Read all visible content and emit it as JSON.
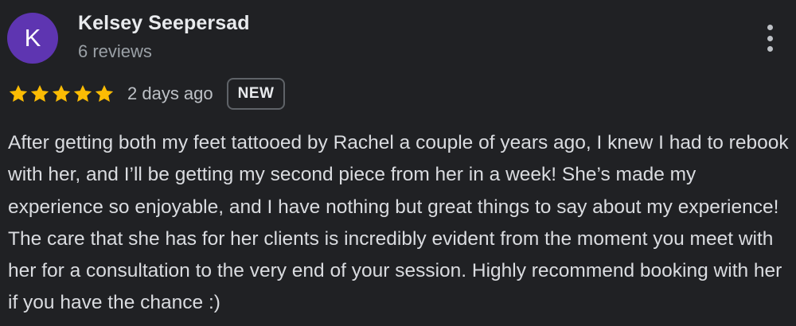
{
  "review": {
    "author": {
      "initial": "K",
      "name": "Kelsey Seepersad",
      "review_count": "6 reviews",
      "avatar_color": "#5e35b1"
    },
    "rating": 5,
    "star_color": "#fbbc04",
    "time_ago": "2 days ago",
    "badge": "NEW",
    "text": "After getting both my feet tattooed by Rachel a couple of years ago, I knew I had to rebook with her, and I’ll be getting my second piece from her in a week! She’s made my experience so enjoyable, and I have nothing but great things to say about my experience! The care that she has for her clients is incredibly evident from the moment you meet with her for a consultation to the very end of your session. Highly recommend booking with her if you have the chance :)",
    "menu_icon": "more-vert-icon"
  }
}
